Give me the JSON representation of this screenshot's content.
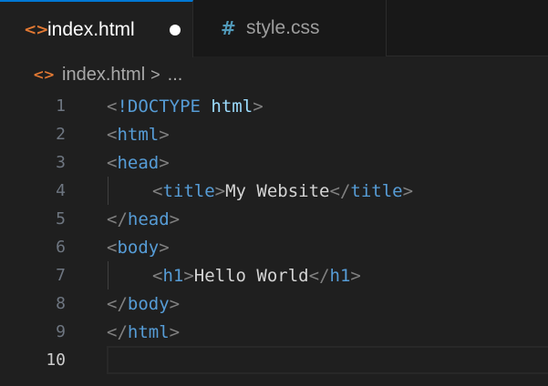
{
  "tabs": [
    {
      "label": "index.html",
      "icon": "html-file-icon",
      "active": true,
      "modified": true
    },
    {
      "label": "style.css",
      "icon": "css-file-icon",
      "active": false,
      "modified": false
    }
  ],
  "breadcrumb": {
    "file": "index.html",
    "separator": ">",
    "ellipsis": "..."
  },
  "editor": {
    "current_line": 10,
    "lines": [
      {
        "number": "1",
        "tokens": [
          [
            "punc",
            "<"
          ],
          [
            "tag",
            "!DOCTYPE"
          ],
          [
            "txt",
            " "
          ],
          [
            "attr",
            "html"
          ],
          [
            "punc",
            ">"
          ]
        ]
      },
      {
        "number": "2",
        "tokens": [
          [
            "punc",
            "<"
          ],
          [
            "tag",
            "html"
          ],
          [
            "punc",
            ">"
          ]
        ]
      },
      {
        "number": "3",
        "tokens": [
          [
            "punc",
            "<"
          ],
          [
            "tag",
            "head"
          ],
          [
            "punc",
            ">"
          ]
        ]
      },
      {
        "number": "4",
        "indent": true,
        "tokens": [
          [
            "punc",
            "<"
          ],
          [
            "tag",
            "title"
          ],
          [
            "punc",
            ">"
          ],
          [
            "txt",
            "My Website"
          ],
          [
            "punc",
            "</"
          ],
          [
            "tag",
            "title"
          ],
          [
            "punc",
            ">"
          ]
        ]
      },
      {
        "number": "5",
        "tokens": [
          [
            "punc",
            "</"
          ],
          [
            "tag",
            "head"
          ],
          [
            "punc",
            ">"
          ]
        ]
      },
      {
        "number": "6",
        "tokens": [
          [
            "punc",
            "<"
          ],
          [
            "tag",
            "body"
          ],
          [
            "punc",
            ">"
          ]
        ]
      },
      {
        "number": "7",
        "indent": true,
        "tokens": [
          [
            "punc",
            "<"
          ],
          [
            "tag",
            "h1"
          ],
          [
            "punc",
            ">"
          ],
          [
            "txt",
            "Hello World"
          ],
          [
            "punc",
            "</"
          ],
          [
            "tag",
            "h1"
          ],
          [
            "punc",
            ">"
          ]
        ]
      },
      {
        "number": "8",
        "tokens": [
          [
            "punc",
            "</"
          ],
          [
            "tag",
            "body"
          ],
          [
            "punc",
            ">"
          ]
        ]
      },
      {
        "number": "9",
        "tokens": [
          [
            "punc",
            "</"
          ],
          [
            "tag",
            "html"
          ],
          [
            "punc",
            ">"
          ]
        ]
      },
      {
        "number": "10",
        "tokens": []
      }
    ]
  },
  "colors": {
    "background": "#1f1f1f",
    "tab_bar": "#181818",
    "tag": "#569cd6",
    "attribute": "#9cdcfe",
    "punctuation": "#808080",
    "text": "#d4d4d4",
    "html_icon": "#e37933",
    "css_icon": "#519aba"
  }
}
